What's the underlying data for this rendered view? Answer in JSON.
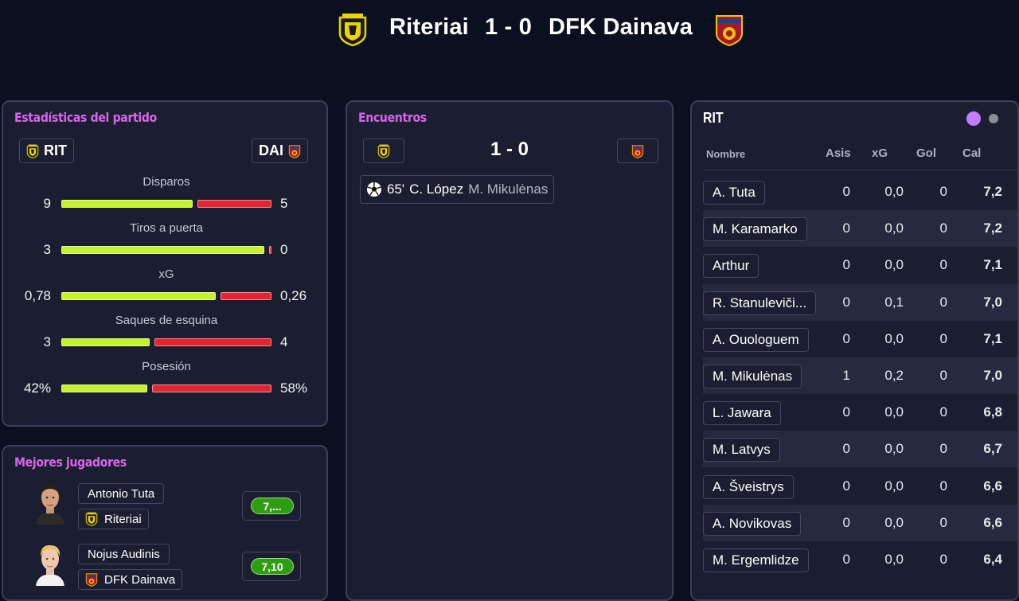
{
  "header": {
    "home_team": "Riteriai",
    "score": "1 - 0",
    "away_team": "DFK Dainava"
  },
  "stats": {
    "title": "Estadísticas del partido",
    "home_abbr": "RIT",
    "away_abbr": "DAI",
    "items": [
      {
        "label": "Disparos",
        "home": "9",
        "away": "5",
        "home_share": 0.64
      },
      {
        "label": "Tiros a puerta",
        "home": "3",
        "away": "0",
        "home_share": 0.99
      },
      {
        "label": "xG",
        "home": "0,78",
        "away": "0,26",
        "home_share": 0.75
      },
      {
        "label": "Saques de esquina",
        "home": "3",
        "away": "4",
        "home_share": 0.43
      },
      {
        "label": "Posesión",
        "home": "42%",
        "away": "58%",
        "home_share": 0.42
      }
    ]
  },
  "best_players": {
    "title": "Mejores jugadores",
    "players": [
      {
        "name": "Antonio Tuta",
        "team": "Riteriai",
        "rating": "7,..."
      },
      {
        "name": "Nojus Audinis",
        "team": "DFK Dainava",
        "rating": "7,10"
      }
    ]
  },
  "encounters": {
    "title": "Encuentros",
    "score": "1 - 0",
    "event": {
      "minute": "65'",
      "scorer": "C. López",
      "assist": "M. Mikulėnas"
    }
  },
  "player_table": {
    "team": "RIT",
    "headers": {
      "name": "Nombre",
      "assists": "Asis",
      "xg": "xG",
      "goals": "Gol",
      "rating": "Cal"
    },
    "rows": [
      {
        "name": "A. Tuta",
        "assists": "0",
        "xg": "0,0",
        "goals": "0",
        "rating": "7,2"
      },
      {
        "name": "M. Karamarko",
        "assists": "0",
        "xg": "0,0",
        "goals": "0",
        "rating": "7,2"
      },
      {
        "name": "Arthur",
        "assists": "0",
        "xg": "0,0",
        "goals": "0",
        "rating": "7,1"
      },
      {
        "name": "R. Stanuleviči...",
        "assists": "0",
        "xg": "0,1",
        "goals": "0",
        "rating": "7,0"
      },
      {
        "name": "A. Ouologuem",
        "assists": "0",
        "xg": "0,0",
        "goals": "0",
        "rating": "7,1"
      },
      {
        "name": "M. Mikulėnas",
        "assists": "1",
        "xg": "0,2",
        "goals": "0",
        "rating": "7,0"
      },
      {
        "name": "L. Jawara",
        "assists": "0",
        "xg": "0,0",
        "goals": "0",
        "rating": "6,8"
      },
      {
        "name": "M. Latvys",
        "assists": "0",
        "xg": "0,0",
        "goals": "0",
        "rating": "6,7"
      },
      {
        "name": "A. Šveistrys",
        "assists": "0",
        "xg": "0,0",
        "goals": "0",
        "rating": "6,6"
      },
      {
        "name": "A. Novikovas",
        "assists": "0",
        "xg": "0,0",
        "goals": "0",
        "rating": "6,6"
      },
      {
        "name": "M. Ergemlidze",
        "assists": "0",
        "xg": "0,0",
        "goals": "0",
        "rating": "6,4"
      }
    ]
  },
  "colors": {
    "accent": "#d667e8",
    "home_bar": "#c6f12d",
    "away_bar": "#e0262f",
    "rating_green": "#2e9d12",
    "dot_active": "#c77dff",
    "dot_inactive": "#8b8e99"
  },
  "icons": {
    "home_crest": "riteriai-crest-icon",
    "away_crest": "dainava-crest-icon",
    "goal": "soccer-ball-icon"
  }
}
